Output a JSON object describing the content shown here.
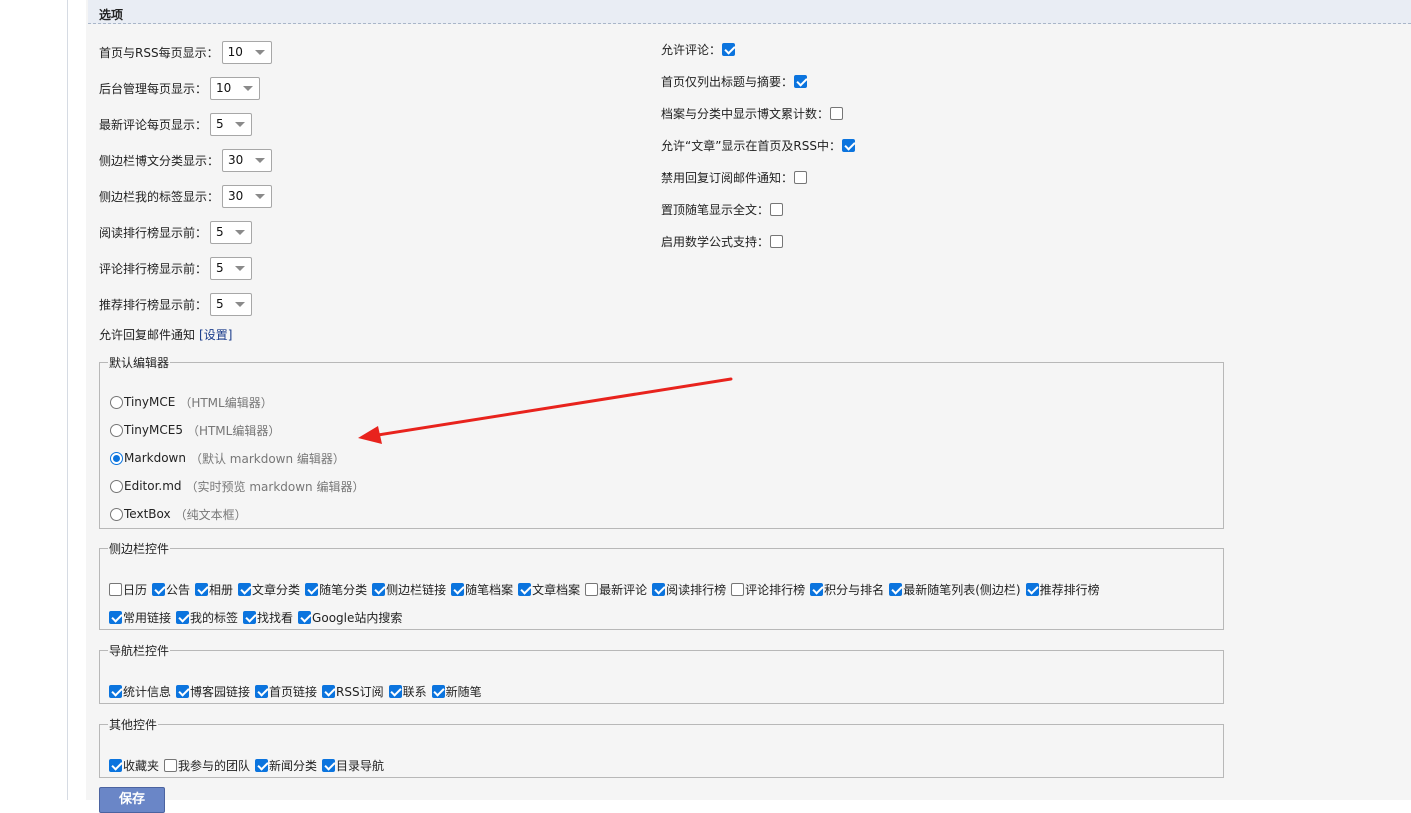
{
  "section_title": "选项",
  "left_settings": [
    {
      "label": "首页与RSS每页显示：",
      "value": "10"
    },
    {
      "label": "后台管理每页显示：",
      "value": "10"
    },
    {
      "label": "最新评论每页显示：",
      "value": "5"
    },
    {
      "label": "侧边栏博文分类显示：",
      "value": "30"
    },
    {
      "label": "侧边栏我的标签显示：",
      "value": "30"
    },
    {
      "label": "阅读排行榜显示前：",
      "value": "5"
    },
    {
      "label": "评论排行榜显示前：",
      "value": "5"
    },
    {
      "label": "推荐排行榜显示前：",
      "value": "5"
    }
  ],
  "reply_notify": {
    "label": "允许回复邮件通知",
    "link": "[设置]"
  },
  "right_settings": [
    {
      "label": "允许评论：",
      "checked": true
    },
    {
      "label": "首页仅列出标题与摘要：",
      "checked": true
    },
    {
      "label": "档案与分类中显示博文累计数：",
      "checked": false
    },
    {
      "label": "允许“文章”显示在首页及RSS中：",
      "checked": true
    },
    {
      "label": "禁用回复订阅邮件通知：",
      "checked": false
    },
    {
      "label": "置顶随笔显示全文：",
      "checked": false
    },
    {
      "label": "启用数学公式支持：",
      "checked": false
    }
  ],
  "editor": {
    "legend": "默认编辑器",
    "options": [
      {
        "name": "TinyMCE",
        "desc": "（HTML编辑器）",
        "selected": false
      },
      {
        "name": "TinyMCE5",
        "desc": "（HTML编辑器）",
        "selected": false
      },
      {
        "name": "Markdown",
        "desc": "（默认 markdown 编辑器）",
        "selected": true
      },
      {
        "name": "Editor.md",
        "desc": "（实时预览 markdown 编辑器）",
        "selected": false
      },
      {
        "name": "TextBox",
        "desc": "（纯文本框）",
        "selected": false
      }
    ]
  },
  "sidebar_controls": {
    "legend": "侧边栏控件",
    "row1": [
      {
        "label": "日历",
        "checked": false
      },
      {
        "label": "公告",
        "checked": true
      },
      {
        "label": "相册",
        "checked": true
      },
      {
        "label": "文章分类",
        "checked": true
      },
      {
        "label": "随笔分类",
        "checked": true
      },
      {
        "label": "侧边栏链接",
        "checked": true
      },
      {
        "label": "随笔档案",
        "checked": true
      },
      {
        "label": "文章档案",
        "checked": true
      },
      {
        "label": "最新评论",
        "checked": false
      },
      {
        "label": "阅读排行榜",
        "checked": true
      },
      {
        "label": "评论排行榜",
        "checked": false
      },
      {
        "label": "积分与排名",
        "checked": true
      },
      {
        "label": "最新随笔列表(侧边栏)",
        "checked": true
      },
      {
        "label": "推荐排行榜",
        "checked": true
      }
    ],
    "row2": [
      {
        "label": "常用链接",
        "checked": true
      },
      {
        "label": "我的标签",
        "checked": true
      },
      {
        "label": "找找看",
        "checked": true
      },
      {
        "label": "Google站内搜索",
        "checked": true
      }
    ]
  },
  "nav_controls": {
    "legend": "导航栏控件",
    "items": [
      {
        "label": "统计信息",
        "checked": true
      },
      {
        "label": "博客园链接",
        "checked": true
      },
      {
        "label": "首页链接",
        "checked": true
      },
      {
        "label": "RSS订阅",
        "checked": true
      },
      {
        "label": "联系",
        "checked": true
      },
      {
        "label": "新随笔",
        "checked": true
      }
    ]
  },
  "other_controls": {
    "legend": "其他控件",
    "items": [
      {
        "label": "收藏夹",
        "checked": true
      },
      {
        "label": "我参与的团队",
        "checked": false
      },
      {
        "label": "新闻分类",
        "checked": true
      },
      {
        "label": "目录导航",
        "checked": true
      }
    ]
  },
  "save_label": "保存",
  "colors": {
    "accent": "#0b74de",
    "arrow": "#e8231d",
    "save_button": "#6a86c7"
  },
  "annotation": {
    "type": "arrow",
    "points_to": "Markdown"
  }
}
